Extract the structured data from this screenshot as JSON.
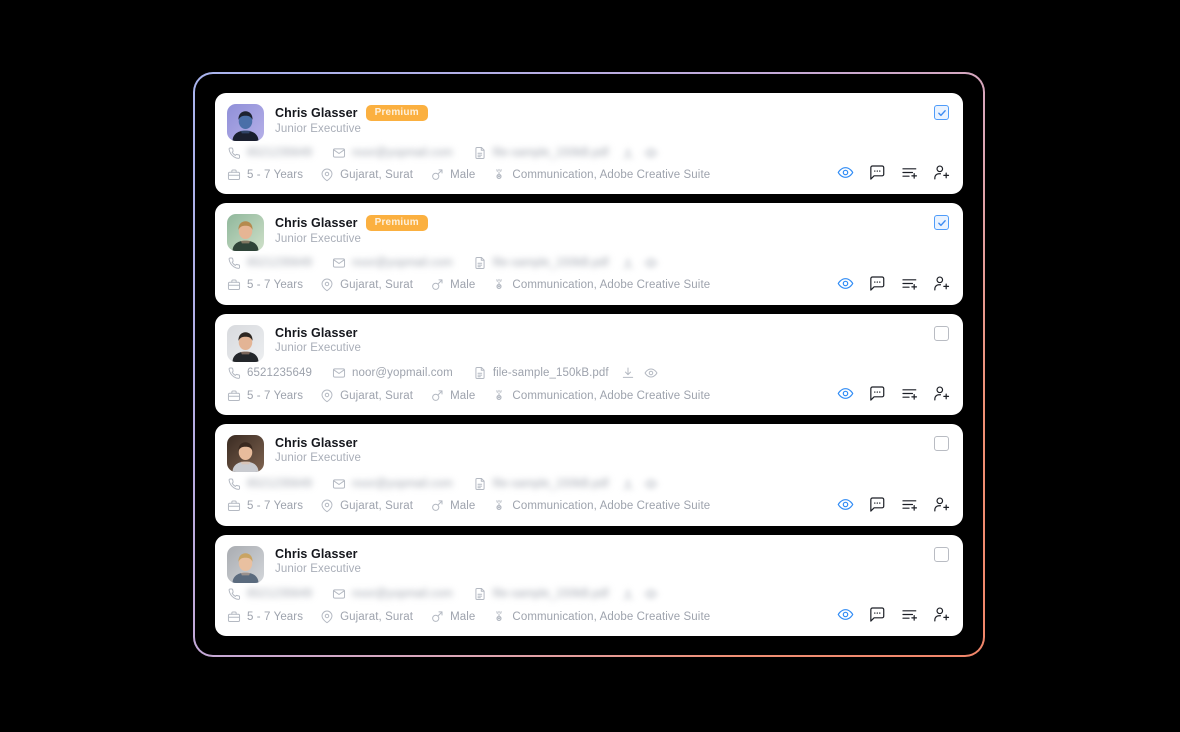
{
  "theme": {
    "frame_gradient_start": "#a9b4ee",
    "frame_gradient_end": "#f08569",
    "badge_bg": "#fbb040",
    "badge_text": "#fdf0dc",
    "checkbox_checked_border": "#4f9cf9",
    "checkbox_checked_bg": "#eaf3ff",
    "view_icon_color": "#2f8bf5",
    "card_bg": "#ffffff",
    "page_bg": "#000000"
  },
  "actions": {
    "view": "view-icon",
    "comment": "comment-icon",
    "shortlist": "add-to-list-icon",
    "add_user": "add-user-icon"
  },
  "cards": [
    {
      "name": "Chris Glasser",
      "badge": "Premium",
      "role": "Junior Executive",
      "phone": "6521235649",
      "email": "noor@yopmail.com",
      "resume": "file-sample_150kB.pdf",
      "experience": "5 - 7 Years",
      "location": "Gujarat, Surat",
      "gender": "Male",
      "skills": "Communication, Adobe Creative Suite",
      "selected": true,
      "blurred": true,
      "avatar": "avatar-woman-purple"
    },
    {
      "name": "Chris Glasser",
      "badge": "Premium",
      "role": "Junior Executive",
      "phone": "6521235649",
      "email": "noor@yopmail.com",
      "resume": "file-sample_150kB.pdf",
      "experience": "5 - 7 Years",
      "location": "Gujarat, Surat",
      "gender": "Male",
      "skills": "Communication, Adobe Creative Suite",
      "selected": true,
      "blurred": true,
      "avatar": "avatar-man-glasses-green"
    },
    {
      "name": "Chris Glasser",
      "badge": "",
      "role": "Junior Executive",
      "phone": "6521235649",
      "email": "noor@yopmail.com",
      "resume": "file-sample_150kB.pdf",
      "experience": "5 - 7 Years",
      "location": "Gujarat, Surat",
      "gender": "Male",
      "skills": "Communication, Adobe Creative Suite",
      "selected": false,
      "blurred": false,
      "avatar": "avatar-man-gray"
    },
    {
      "name": "Chris Glasser",
      "badge": "",
      "role": "Junior Executive",
      "phone": "6521235649",
      "email": "noor@yopmail.com",
      "resume": "file-sample_150kB.pdf",
      "experience": "5 - 7 Years",
      "location": "Gujarat, Surat",
      "gender": "Male",
      "skills": "Communication, Adobe Creative Suite",
      "selected": false,
      "blurred": true,
      "avatar": "avatar-woman-dark"
    },
    {
      "name": "Chris Glasser",
      "badge": "",
      "role": "Junior Executive",
      "phone": "6521235649",
      "email": "noor@yopmail.com",
      "resume": "file-sample_150kB.pdf",
      "experience": "5 - 7 Years",
      "location": "Gujarat, Surat",
      "gender": "Male",
      "skills": "Communication, Adobe Creative Suite",
      "selected": false,
      "blurred": true,
      "avatar": "avatar-man-blond-gray"
    }
  ]
}
